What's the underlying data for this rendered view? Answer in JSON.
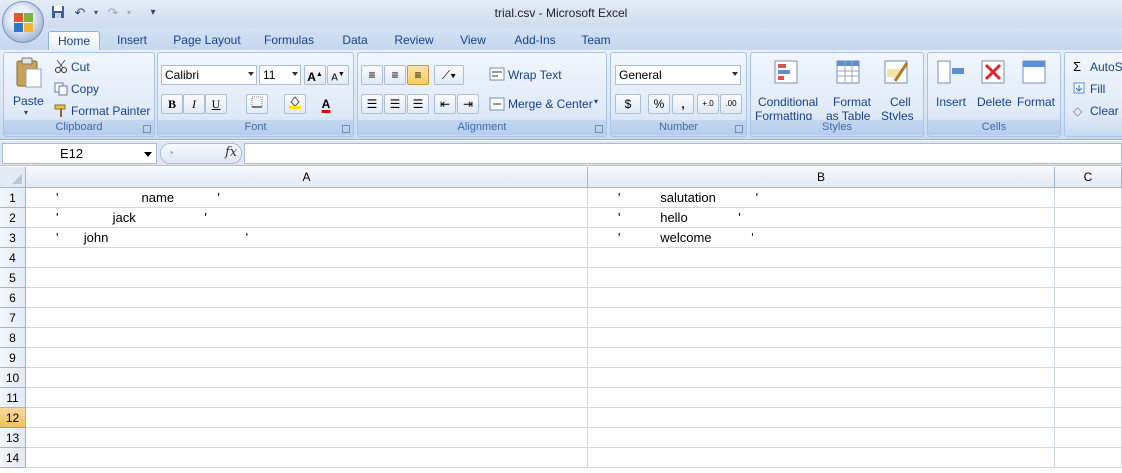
{
  "window": {
    "title": "trial.csv - Microsoft Excel"
  },
  "tabs": [
    "Home",
    "Insert",
    "Page Layout",
    "Formulas",
    "Data",
    "Review",
    "View",
    "Add-Ins",
    "Team"
  ],
  "clipboard": {
    "paste": "Paste",
    "cut": "Cut",
    "copy": "Copy",
    "format_painter": "Format Painter",
    "label": "Clipboard"
  },
  "font": {
    "name": "Calibri",
    "size": "11",
    "bold": "B",
    "italic": "I",
    "underline": "U",
    "color_glyph": "A",
    "label": "Font"
  },
  "alignment": {
    "wrap": "Wrap Text",
    "merge": "Merge & Center",
    "label": "Alignment"
  },
  "number": {
    "format": "General",
    "currency": "$",
    "percent": "%",
    "comma": ",",
    "label": "Number"
  },
  "styles": {
    "cond1": "Conditional",
    "cond2": "Formatting",
    "fmt1": "Format",
    "fmt2": "as Table",
    "cell1": "Cell",
    "cell2": "Styles",
    "label": "Styles"
  },
  "cells": {
    "insert": "Insert",
    "delete": "Delete",
    "format": "Format",
    "label": "Cells"
  },
  "editing": {
    "autosum": "AutoS",
    "fill": "Fill",
    "clear": "Clear"
  },
  "formula_bar": {
    "name_box": "E12",
    "fx": "fx",
    "content": ""
  },
  "columns": [
    "A",
    "B",
    "C"
  ],
  "rows": [
    "1",
    "2",
    "3",
    "4",
    "5",
    "6",
    "7",
    "8",
    "9",
    "10",
    "11",
    "12",
    "13",
    "14"
  ],
  "selected_row": "12",
  "cells_data": {
    "A1": "'                       name            '",
    "B1": "'           salutation           '",
    "A2": "'               jack                   '",
    "B2": "'           hello              '",
    "A3": "'       john                                      '",
    "B3": "'           welcome           '"
  },
  "colors": {
    "accent": "#15428b",
    "ribbon": "#dbe7f6",
    "selected_row": "#f1c15f",
    "gridline": "#d0d7e5"
  }
}
